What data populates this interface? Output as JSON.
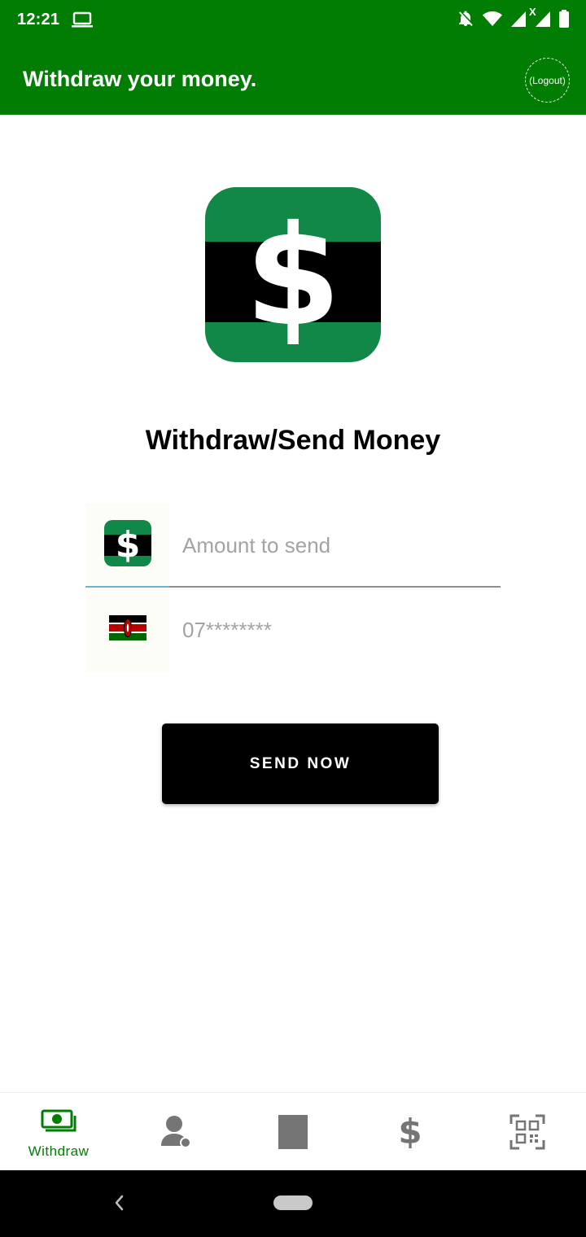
{
  "status_bar": {
    "time": "12:21",
    "left_icons": [
      "laptop-icon"
    ],
    "right_icons": [
      "notifications-off-icon",
      "wifi-icon",
      "cell-signal-icon",
      "cell-signal-no-data-icon",
      "battery-icon"
    ],
    "signal_badge": "X"
  },
  "app_bar": {
    "title": "Withdraw your money.",
    "logout_label": "(Logout)",
    "background_color": "#027d03"
  },
  "main": {
    "logo_icon": "dollar-logo-icon",
    "heading": "Withdraw/Send Money",
    "amount_field": {
      "placeholder": "Amount to send",
      "value": "",
      "icon": "dollar-logo-icon"
    },
    "phone_field": {
      "placeholder": "07********",
      "value": "",
      "icon": "kenya-flag-icon"
    },
    "send_button_label": "SEND NOW"
  },
  "bottom_nav": {
    "items": [
      {
        "icon": "banknote-icon",
        "label": "Withdraw",
        "active": true
      },
      {
        "icon": "support-agent-icon",
        "label": "",
        "active": false
      },
      {
        "icon": "square-icon",
        "label": "",
        "active": false
      },
      {
        "icon": "dollar-icon",
        "label": "",
        "active": false
      },
      {
        "icon": "qr-scan-icon",
        "label": "",
        "active": false
      }
    ],
    "active_color": "#027d03",
    "inactive_color": "#757575"
  },
  "system_nav": {
    "icons": [
      "back-icon",
      "home-pill-icon"
    ]
  }
}
